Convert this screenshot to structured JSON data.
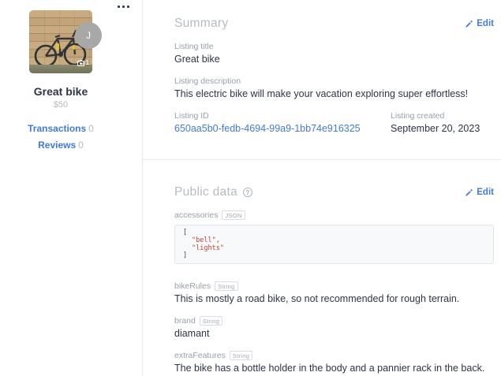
{
  "sidebar": {
    "avatar_letter": "J",
    "photo_badge_count": "1",
    "title": "Great bike",
    "price": "$50",
    "links": [
      {
        "label": "Transactions",
        "count": "0"
      },
      {
        "label": "Reviews",
        "count": "0"
      }
    ]
  },
  "summary": {
    "heading": "Summary",
    "edit_label": "Edit",
    "fields": {
      "title": {
        "label": "Listing title",
        "value": "Great bike"
      },
      "description": {
        "label": "Listing description",
        "value": "This electric bike will make your vacation exploring super effortless!"
      },
      "id": {
        "label": "Listing ID",
        "value": "650aa5b0-fedb-4694-99a9-1bb74e916325"
      },
      "created": {
        "label": "Listing created",
        "value": "September 20, 2023"
      }
    }
  },
  "public_data": {
    "heading": "Public data",
    "help_glyph": "?",
    "edit_label": "Edit",
    "accessories": {
      "name": "accessories",
      "type": "JSON",
      "code": {
        "open": "[",
        "item1": "\"bell\",",
        "item2": "\"lights\"",
        "close": "]"
      }
    },
    "bike_rules": {
      "name": "bikeRules",
      "type": "String",
      "value": "This is mostly a road bike, so not recommended for rough terrain."
    },
    "brand": {
      "name": "brand",
      "type": "String",
      "value": "diamant"
    },
    "extra_features": {
      "name": "extraFeatures",
      "type": "String",
      "value": "The bike has a bottle holder in the body and a pannier rack in the back."
    }
  },
  "colors": {
    "link_blue": "#4379e2",
    "text_dark": "#2c3547",
    "label_grey": "#99a0ab",
    "heading_grey": "#b6bcc4",
    "code_string_red": "#c04036",
    "divider": "#e8eaee"
  }
}
